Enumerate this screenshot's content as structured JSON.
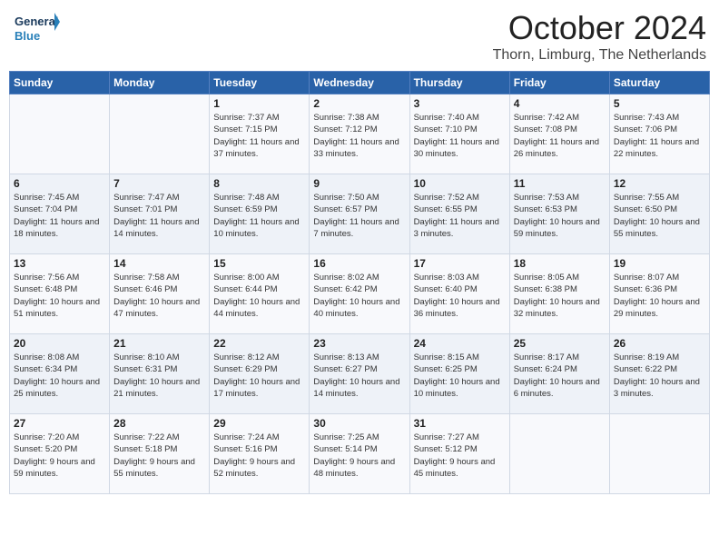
{
  "header": {
    "logo_general": "General",
    "logo_blue": "Blue",
    "month": "October 2024",
    "location": "Thorn, Limburg, The Netherlands"
  },
  "weekdays": [
    "Sunday",
    "Monday",
    "Tuesday",
    "Wednesday",
    "Thursday",
    "Friday",
    "Saturday"
  ],
  "weeks": [
    [
      {
        "day": "",
        "info": ""
      },
      {
        "day": "",
        "info": ""
      },
      {
        "day": "1",
        "info": "Sunrise: 7:37 AM\nSunset: 7:15 PM\nDaylight: 11 hours and 37 minutes."
      },
      {
        "day": "2",
        "info": "Sunrise: 7:38 AM\nSunset: 7:12 PM\nDaylight: 11 hours and 33 minutes."
      },
      {
        "day": "3",
        "info": "Sunrise: 7:40 AM\nSunset: 7:10 PM\nDaylight: 11 hours and 30 minutes."
      },
      {
        "day": "4",
        "info": "Sunrise: 7:42 AM\nSunset: 7:08 PM\nDaylight: 11 hours and 26 minutes."
      },
      {
        "day": "5",
        "info": "Sunrise: 7:43 AM\nSunset: 7:06 PM\nDaylight: 11 hours and 22 minutes."
      }
    ],
    [
      {
        "day": "6",
        "info": "Sunrise: 7:45 AM\nSunset: 7:04 PM\nDaylight: 11 hours and 18 minutes."
      },
      {
        "day": "7",
        "info": "Sunrise: 7:47 AM\nSunset: 7:01 PM\nDaylight: 11 hours and 14 minutes."
      },
      {
        "day": "8",
        "info": "Sunrise: 7:48 AM\nSunset: 6:59 PM\nDaylight: 11 hours and 10 minutes."
      },
      {
        "day": "9",
        "info": "Sunrise: 7:50 AM\nSunset: 6:57 PM\nDaylight: 11 hours and 7 minutes."
      },
      {
        "day": "10",
        "info": "Sunrise: 7:52 AM\nSunset: 6:55 PM\nDaylight: 11 hours and 3 minutes."
      },
      {
        "day": "11",
        "info": "Sunrise: 7:53 AM\nSunset: 6:53 PM\nDaylight: 10 hours and 59 minutes."
      },
      {
        "day": "12",
        "info": "Sunrise: 7:55 AM\nSunset: 6:50 PM\nDaylight: 10 hours and 55 minutes."
      }
    ],
    [
      {
        "day": "13",
        "info": "Sunrise: 7:56 AM\nSunset: 6:48 PM\nDaylight: 10 hours and 51 minutes."
      },
      {
        "day": "14",
        "info": "Sunrise: 7:58 AM\nSunset: 6:46 PM\nDaylight: 10 hours and 47 minutes."
      },
      {
        "day": "15",
        "info": "Sunrise: 8:00 AM\nSunset: 6:44 PM\nDaylight: 10 hours and 44 minutes."
      },
      {
        "day": "16",
        "info": "Sunrise: 8:02 AM\nSunset: 6:42 PM\nDaylight: 10 hours and 40 minutes."
      },
      {
        "day": "17",
        "info": "Sunrise: 8:03 AM\nSunset: 6:40 PM\nDaylight: 10 hours and 36 minutes."
      },
      {
        "day": "18",
        "info": "Sunrise: 8:05 AM\nSunset: 6:38 PM\nDaylight: 10 hours and 32 minutes."
      },
      {
        "day": "19",
        "info": "Sunrise: 8:07 AM\nSunset: 6:36 PM\nDaylight: 10 hours and 29 minutes."
      }
    ],
    [
      {
        "day": "20",
        "info": "Sunrise: 8:08 AM\nSunset: 6:34 PM\nDaylight: 10 hours and 25 minutes."
      },
      {
        "day": "21",
        "info": "Sunrise: 8:10 AM\nSunset: 6:31 PM\nDaylight: 10 hours and 21 minutes."
      },
      {
        "day": "22",
        "info": "Sunrise: 8:12 AM\nSunset: 6:29 PM\nDaylight: 10 hours and 17 minutes."
      },
      {
        "day": "23",
        "info": "Sunrise: 8:13 AM\nSunset: 6:27 PM\nDaylight: 10 hours and 14 minutes."
      },
      {
        "day": "24",
        "info": "Sunrise: 8:15 AM\nSunset: 6:25 PM\nDaylight: 10 hours and 10 minutes."
      },
      {
        "day": "25",
        "info": "Sunrise: 8:17 AM\nSunset: 6:24 PM\nDaylight: 10 hours and 6 minutes."
      },
      {
        "day": "26",
        "info": "Sunrise: 8:19 AM\nSunset: 6:22 PM\nDaylight: 10 hours and 3 minutes."
      }
    ],
    [
      {
        "day": "27",
        "info": "Sunrise: 7:20 AM\nSunset: 5:20 PM\nDaylight: 9 hours and 59 minutes."
      },
      {
        "day": "28",
        "info": "Sunrise: 7:22 AM\nSunset: 5:18 PM\nDaylight: 9 hours and 55 minutes."
      },
      {
        "day": "29",
        "info": "Sunrise: 7:24 AM\nSunset: 5:16 PM\nDaylight: 9 hours and 52 minutes."
      },
      {
        "day": "30",
        "info": "Sunrise: 7:25 AM\nSunset: 5:14 PM\nDaylight: 9 hours and 48 minutes."
      },
      {
        "day": "31",
        "info": "Sunrise: 7:27 AM\nSunset: 5:12 PM\nDaylight: 9 hours and 45 minutes."
      },
      {
        "day": "",
        "info": ""
      },
      {
        "day": "",
        "info": ""
      }
    ]
  ]
}
